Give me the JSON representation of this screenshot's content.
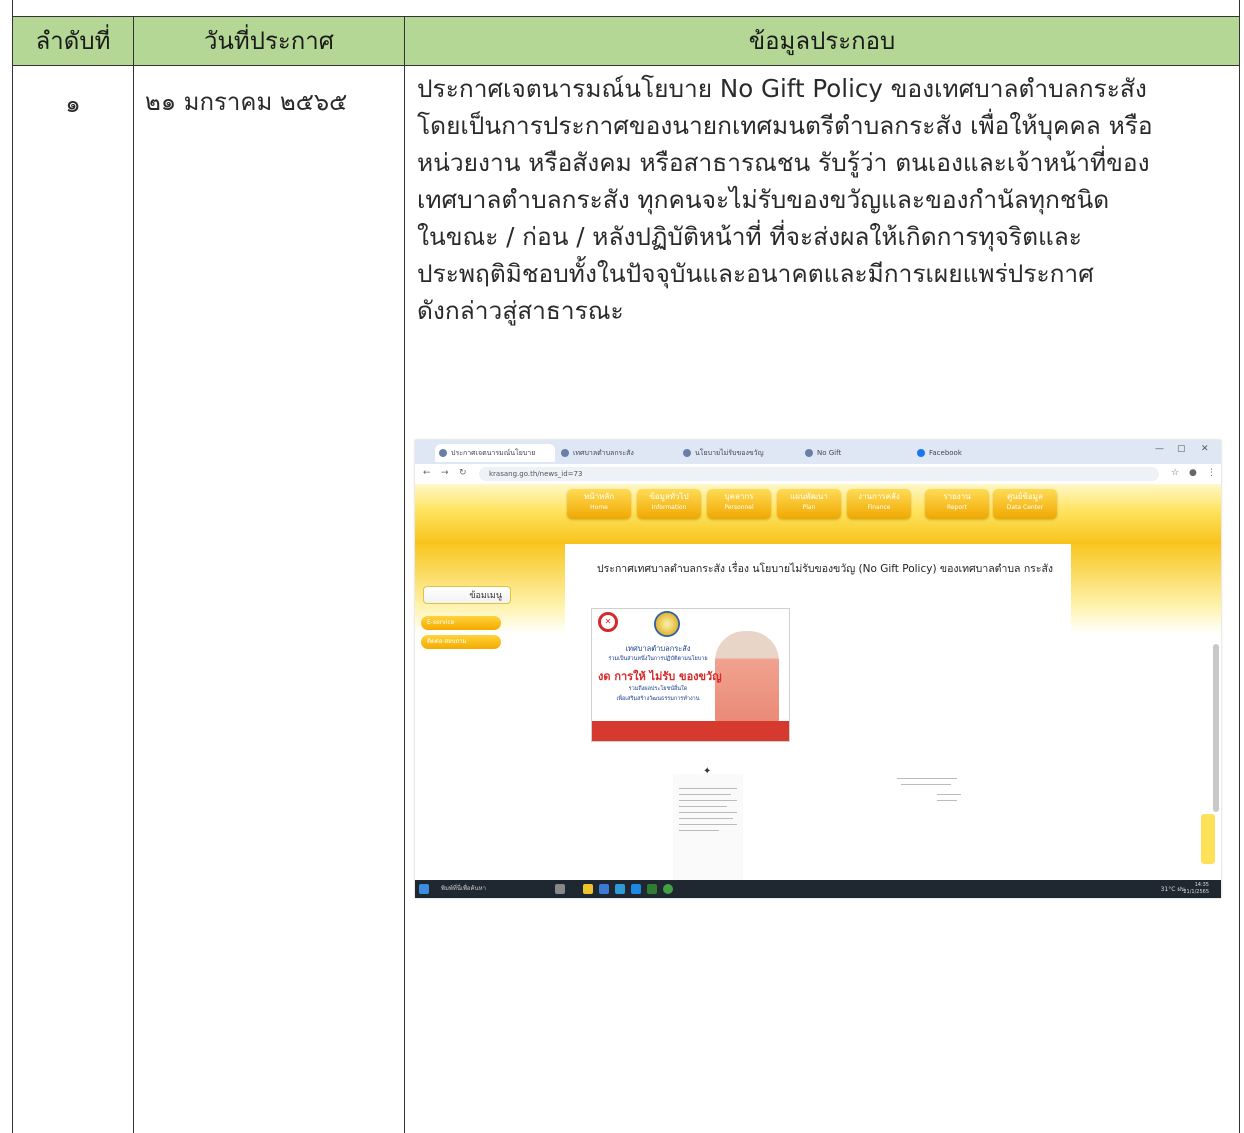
{
  "table": {
    "headers": {
      "order": "ลำดับที่",
      "date": "วันที่ประกาศ",
      "info": "ข้อมูลประกอบ"
    },
    "rows": [
      {
        "order": "๑",
        "date": "๒๑ มกราคม ๒๕๖๕",
        "detail_lines": [
          "ประกาศเจตนารมณ์นโยบาย No Gift Policy ของเทศบาลตำบลกระสัง",
          "โดยเป็นการประกาศของนายกเทศมนตรีตำบลกระสัง เพื่อให้บุคคล หรือ",
          "หน่วยงาน หรือสังคม หรือสาธารณชน รับรู้ว่า ตนเองและเจ้าหน้าที่ของ",
          "เทศบาลตำบลกระสัง ทุกคนจะไม่รับของขวัญและของกำนัลทุกชนิด",
          "ในขณะ / ก่อน / หลังปฏิบัติหน้าที่ ที่จะส่งผลให้เกิดการทุจริตและ",
          "ประพฤติมิชอบทั้งในปัจจุบันและอนาคตและมีการเผยแพร่ประกาศ",
          "ดังกล่าวสู่สาธารณะ"
        ]
      }
    ]
  },
  "screenshot": {
    "url": "krasang.go.th/news_id=73",
    "tabs": [
      "ประกาศเจตนารมณ์นโยบาย",
      "เทศบาลตำบลกระสัง",
      "นโยบายไม่รับของขวัญ",
      "No Gift",
      "Facebook"
    ],
    "window_controls": [
      "—",
      "▢",
      "✕"
    ],
    "menu": [
      {
        "th": "หน้าหลัก",
        "en": "Home"
      },
      {
        "th": "ข้อมูลทั่วไป",
        "en": "Information"
      },
      {
        "th": "บุคลากร",
        "en": "Personnel"
      },
      {
        "th": "แผนพัฒนา",
        "en": "Plan"
      },
      {
        "th": "งานการคลัง",
        "en": "Finance"
      },
      {
        "th": "รายงาน",
        "en": "Report"
      },
      {
        "th": "ศูนย์ข้อมูล",
        "en": "Data Center"
      }
    ],
    "page_title": "ประกาศเทศบาลตำบลกระสัง เรื่อง นโยบายไม่รับของขวัญ (No Gift Policy) ของเทศบาลตำบล กระสัง",
    "sidebar_head": "ข้อมเมนู",
    "sidebar_items": [
      "E-service",
      "ติดต่อ-สอบถาม"
    ],
    "poster": {
      "line1": "เทศบาลตำบลกระสัง",
      "line2": "ร่วมเป็นส่วนหนึ่งในการปฏิบัติตามนโยบาย",
      "line3": "งด การให้ ไม่รับ ของขวัญ",
      "line4": "รวมถึงผลประโยชน์อื่นใด",
      "line5": "เพื่อเสริมสร้างวัฒนธรรมการทำงาน"
    },
    "taskbar_search": "พิมพ์ที่นี่เพื่อค้นหา",
    "taskbar_status": "31°C ฝน",
    "taskbar_time": "14:35",
    "taskbar_date": "21/1/2565"
  },
  "colors": {
    "header_bg": "#b5d795",
    "menu_gold": "#f0a800",
    "poster_red": "#d63a2f",
    "taskbar": "#1f2730"
  }
}
